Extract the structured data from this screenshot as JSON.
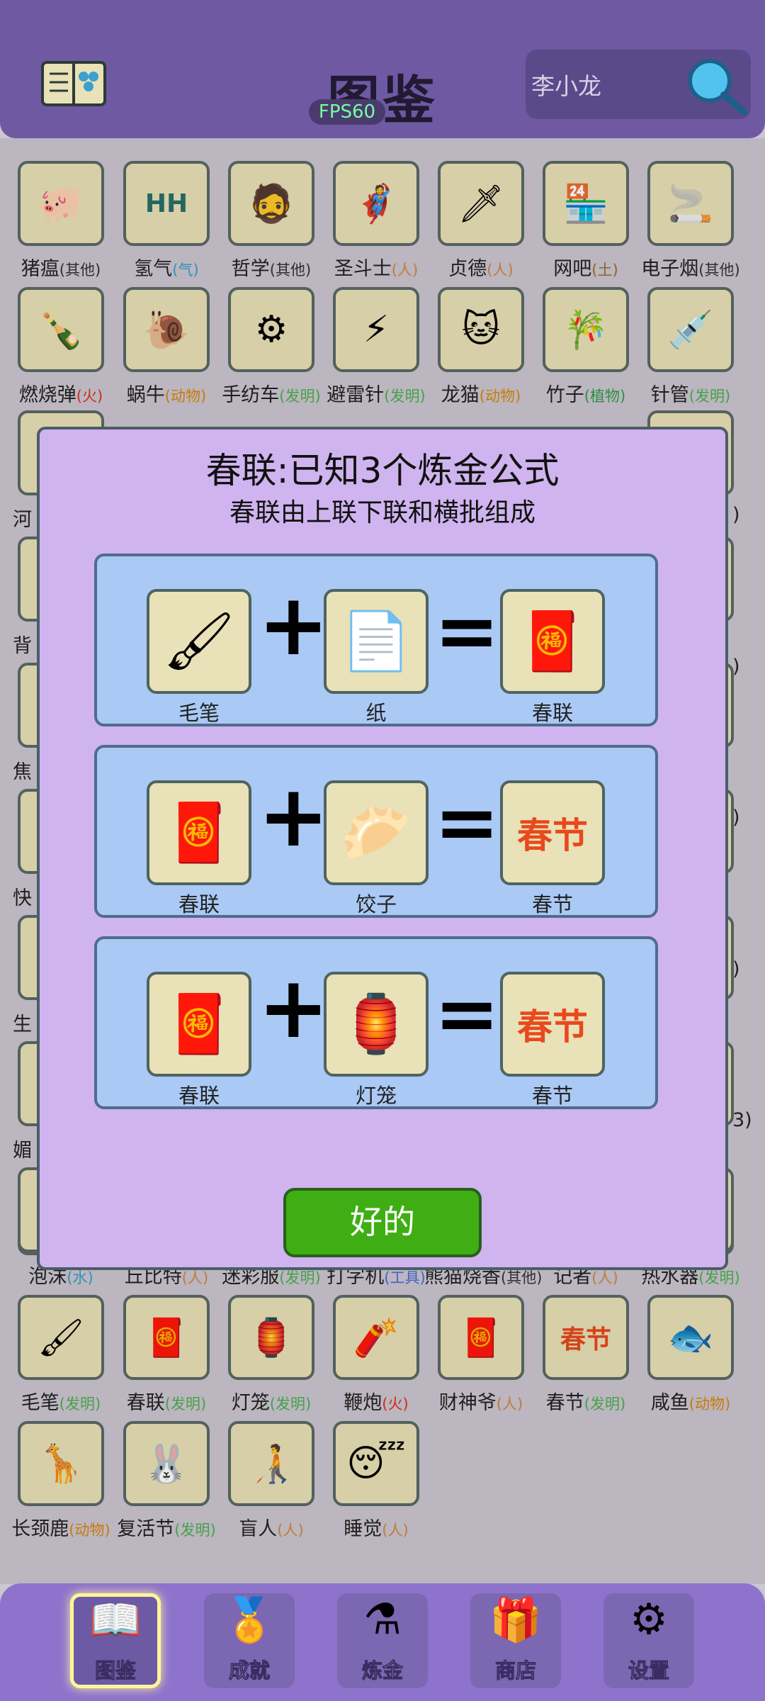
{
  "header": {
    "title": "图鉴",
    "fps": "FPS60",
    "search_placeholder": "李小龙"
  },
  "row_partial_top": [
    "猪瘟",
    "氢气",
    "哲学",
    "圣斗士",
    "贞德",
    "网吧",
    "电子烟"
  ],
  "grid_rows": [
    [
      {
        "name": "猪瘟",
        "cat": "其他",
        "color": "#333333",
        "icon": "🐖"
      },
      {
        "name": "氢气",
        "cat": "气",
        "color": "#34a0c8",
        "icon": "HH"
      },
      {
        "name": "哲学",
        "cat": "其他",
        "color": "#333333",
        "icon": "🧔"
      },
      {
        "name": "圣斗士",
        "cat": "人",
        "color": "#d2863a",
        "icon": "🦸"
      },
      {
        "name": "贞德",
        "cat": "人",
        "color": "#d2863a",
        "icon": "🗡"
      },
      {
        "name": "网吧",
        "cat": "土",
        "color": "#9a6b2a",
        "icon": "🏪"
      },
      {
        "name": "电子烟",
        "cat": "其他",
        "color": "#333333",
        "icon": "🚬"
      }
    ],
    [
      {
        "name": "燃烧弹",
        "cat": "火",
        "color": "#e0301e",
        "icon": "🍾"
      },
      {
        "name": "蜗牛",
        "cat": "动物",
        "color": "#d8860e",
        "icon": "🐌"
      },
      {
        "name": "手纺车",
        "cat": "发明",
        "color": "#4caf50",
        "icon": "⚙"
      },
      {
        "name": "避雷针",
        "cat": "发明",
        "color": "#4caf50",
        "icon": "⚡"
      },
      {
        "name": "龙猫",
        "cat": "动物",
        "color": "#d8860e",
        "icon": "🐱"
      },
      {
        "name": "竹子",
        "cat": "植物",
        "color": "#2e9c4a",
        "icon": "🎋"
      },
      {
        "name": "针管",
        "cat": "发明",
        "color": "#4caf50",
        "icon": "💉"
      }
    ]
  ],
  "grid_bottom": [
    [
      {
        "name": "毛笔",
        "cat": "发明",
        "color": "#4caf50",
        "icon": "🖌"
      },
      {
        "name": "春联",
        "cat": "发明",
        "color": "#4caf50",
        "icon": "🧧"
      },
      {
        "name": "灯笼",
        "cat": "发明",
        "color": "#4caf50",
        "icon": "🏮"
      },
      {
        "name": "鞭炮",
        "cat": "火",
        "color": "#e0301e",
        "icon": "🧨"
      },
      {
        "name": "财神爷",
        "cat": "人",
        "color": "#d2863a",
        "icon": "🧧"
      },
      {
        "name": "春节",
        "cat": "发明",
        "color": "#4caf50",
        "icon": "春节"
      },
      {
        "name": "咸鱼",
        "cat": "动物",
        "color": "#d8860e",
        "icon": "🐟"
      }
    ],
    [
      {
        "name": "长颈鹿",
        "cat": "动物",
        "color": "#d8860e",
        "icon": "🦒"
      },
      {
        "name": "复活节",
        "cat": "发明",
        "color": "#4caf50",
        "icon": "🐰"
      },
      {
        "name": "盲人",
        "cat": "人",
        "color": "#d2863a",
        "icon": "🧑‍🦯"
      },
      {
        "name": "睡觉",
        "cat": "人",
        "color": "#d2863a",
        "icon": "😴"
      }
    ]
  ],
  "partial_row_above_bottom": [
    "泡沫",
    "丘比特",
    "迷彩服",
    "打字机",
    "熊猫烧香",
    "记者",
    "热水器"
  ],
  "partial_cats_above_bottom": [
    {
      "cat": "水",
      "color": "#34a0c8"
    },
    {
      "cat": "人",
      "color": "#d2863a"
    },
    {
      "cat": "发明",
      "color": "#4caf50"
    },
    {
      "cat": "工具",
      "color": "#4a6cd8"
    },
    {
      "cat": "其他",
      "color": "#333333"
    },
    {
      "cat": "人",
      "color": "#d2863a"
    },
    {
      "cat": "发明",
      "color": "#4caf50"
    }
  ],
  "left_edge_labels": [
    "河",
    "背",
    "焦",
    "快",
    "生",
    "媚"
  ],
  "right_edge_labels": [
    ")",
    ")",
    ")",
    ")",
    "3)"
  ],
  "modal": {
    "title": "春联:已知3个炼金公式",
    "subtitle": "春联由上联下联和横批组成",
    "recipes": [
      {
        "a": "毛笔",
        "b": "纸",
        "result": "春联",
        "a_icon": "🖌",
        "b_icon": "📄",
        "r_icon": "🧧"
      },
      {
        "a": "春联",
        "b": "饺子",
        "result": "春节",
        "a_icon": "🧧",
        "b_icon": "🥟",
        "r_icon": "春节"
      },
      {
        "a": "春联",
        "b": "灯笼",
        "result": "春节",
        "a_icon": "🧧",
        "b_icon": "🏮",
        "r_icon": "春节"
      }
    ],
    "plus": "+",
    "equals": "=",
    "ok_label": "好的"
  },
  "nav": [
    {
      "label": "图鉴",
      "icon": "📖",
      "active": true
    },
    {
      "label": "成就",
      "icon": "🏅",
      "active": false
    },
    {
      "label": "炼金",
      "icon": "⚗",
      "active": false
    },
    {
      "label": "商店",
      "icon": "🎁",
      "active": false
    },
    {
      "label": "设置",
      "icon": "⚙",
      "active": false
    }
  ]
}
